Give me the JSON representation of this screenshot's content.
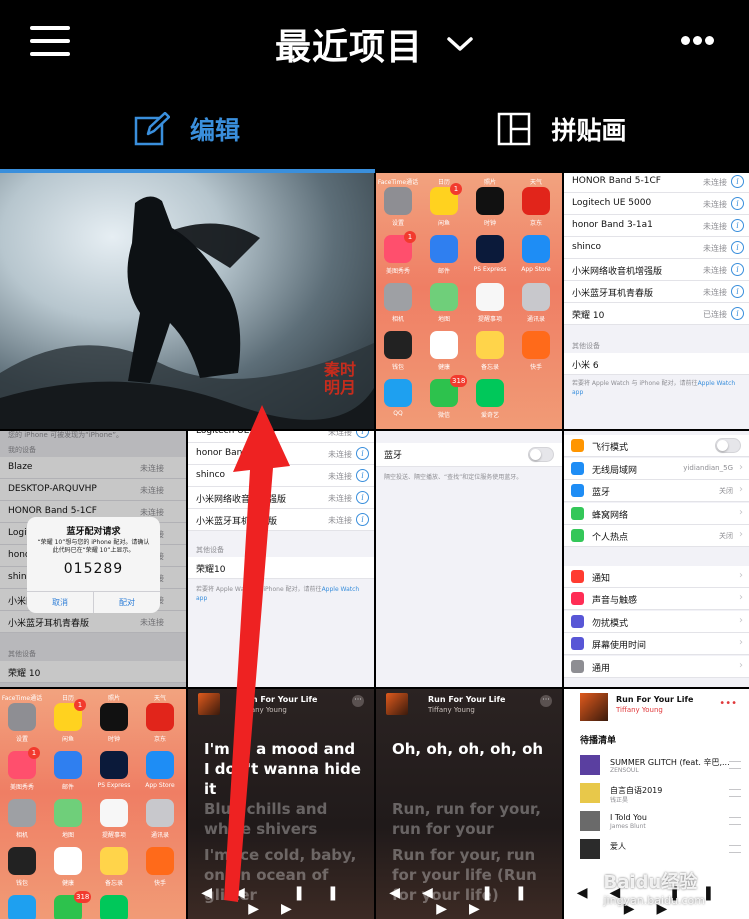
{
  "header": {
    "title": "最近项目"
  },
  "tabs": [
    {
      "label": "编辑"
    },
    {
      "label": "拼贴画"
    }
  ],
  "painting": {
    "seal": "秦时明月"
  },
  "home_apps": [
    {
      "label": "设置",
      "color": "#8e8e93"
    },
    {
      "label": "闲鱼",
      "color": "#ffd21f",
      "badge": "1"
    },
    {
      "label": "时钟",
      "color": "#111111"
    },
    {
      "label": "京东",
      "color": "#e1251b"
    },
    {
      "label": "美图秀秀",
      "color": "#ff4f6d",
      "badge": "1"
    },
    {
      "label": "邮件",
      "color": "#2f7ff0"
    },
    {
      "label": "PS Express",
      "color": "#0b1a3a"
    },
    {
      "label": "App Store",
      "color": "#1e8df5"
    },
    {
      "label": "相机",
      "color": "#9ea0a4"
    },
    {
      "label": "地图",
      "color": "#6fcf7a"
    },
    {
      "label": "提醒事项",
      "color": "#f7f7f7"
    },
    {
      "label": "通讯录",
      "color": "#c8c8cc"
    },
    {
      "label": "钱包",
      "color": "#222222"
    },
    {
      "label": "健康",
      "color": "#ffffff"
    },
    {
      "label": "备忘录",
      "color": "#ffd44a"
    },
    {
      "label": "快手",
      "color": "#ff6a1a"
    },
    {
      "label": "QQ",
      "color": "#1ea0f0"
    },
    {
      "label": "微信",
      "color": "#2dc24d",
      "badge": "318"
    },
    {
      "label": "爱奇艺",
      "color": "#00c85a"
    }
  ],
  "home_top_labels": [
    "FaceTime通话",
    "日历",
    "照片",
    "天气"
  ],
  "bt_devices_a": [
    {
      "name": "HONOR Band 5-1CF",
      "status": "未连接"
    },
    {
      "name": "Logitech UE 5000",
      "status": "未连接"
    },
    {
      "name": "honor Band 3-1a1",
      "status": "未连接"
    },
    {
      "name": "shinco",
      "status": "未连接"
    },
    {
      "name": "小米网络收音机增强版",
      "status": "未连接"
    },
    {
      "name": "小米蓝牙耳机青春版",
      "status": "未连接"
    },
    {
      "name": "荣耀 10",
      "status": "已连接"
    }
  ],
  "other_devices_label": "其他设备",
  "other_device_a": "小米 6",
  "watch_note": "若要将 Apple Watch 与 iPhone 配对，请前往",
  "watch_link": "Apple Watch app",
  "pair_screen": {
    "top_note": "您的 iPhone 可被发现为“iPhone”。",
    "section_label": "我的设备",
    "devices": [
      {
        "name": "Blaze",
        "status": "未连接"
      },
      {
        "name": "DESKTOP-ARQUVHP",
        "status": "未连接"
      },
      {
        "name": "HONOR Band 5-1CF",
        "status": "未连接"
      },
      {
        "name": "Logitech UE 5000",
        "status": "未连接"
      },
      {
        "name": "honor Band 3-1a1",
        "status": "未连接"
      },
      {
        "name": "shinco",
        "status": "未连接"
      },
      {
        "name": "小米网络收音机增强版",
        "status": "未连接"
      },
      {
        "name": "小米蓝牙耳机青春版",
        "status": "未连接"
      }
    ],
    "other_label": "其他设备",
    "other_device": "荣耀 10",
    "dialog": {
      "title": "蓝牙配对请求",
      "message": "“荣耀 10”想与您的 iPhone 配对。请确认此代码已在“荣耀 10”上显示。",
      "code": "015289",
      "cancel": "取消",
      "pair": "配对"
    }
  },
  "bt_devices_b": [
    {
      "name": "Logitech UE 5000",
      "status": "未连接"
    },
    {
      "name": "honor Band 3-1a1",
      "status": "未连接"
    },
    {
      "name": "shinco",
      "status": "未连接"
    },
    {
      "name": "小米网络收音机增强版",
      "status": "未连接"
    },
    {
      "name": "小米蓝牙耳机青春版",
      "status": "未连接"
    }
  ],
  "other_device_b": "荣耀10",
  "bluetooth_toggle": {
    "label": "蓝牙",
    "note": "隔空投送、隔空播放、“查找”和定位服务使用蓝牙。"
  },
  "settings_main": [
    {
      "label": "飞行模式",
      "color": "#ff9500",
      "value": ""
    },
    {
      "label": "无线局域网",
      "color": "#1e8df5",
      "value": "yidiandian_5G"
    },
    {
      "label": "蓝牙",
      "color": "#1e8df5",
      "value": "关闭"
    },
    {
      "label": "蜂窝网络",
      "color": "#34c759",
      "value": ""
    },
    {
      "label": "个人热点",
      "color": "#34c759",
      "value": "关闭"
    },
    {
      "label": "通知",
      "color": "#ff3b30",
      "value": ""
    },
    {
      "label": "声音与触感",
      "color": "#ff2d55",
      "value": ""
    },
    {
      "label": "勿扰模式",
      "color": "#5856d6",
      "value": ""
    },
    {
      "label": "屏幕使用时间",
      "color": "#5856d6",
      "value": ""
    },
    {
      "label": "通用",
      "color": "#8e8e93",
      "value": ""
    }
  ],
  "music": {
    "song": "Run For Your Life",
    "artist": "Tiffany Young",
    "lyrics_a": [
      "I'm in a mood and I don't wanna hide it",
      "Blue chills and white shivers",
      "I'm ice cold, baby, on an ocean of glitter"
    ],
    "lyrics_b": [
      "Oh, oh, oh, oh, oh",
      "Run, run for your, run for your",
      "Run for your, run for your life (Run for your life)"
    ]
  },
  "queue": {
    "song": "Run For Your Life",
    "artist": "Tiffany Young",
    "title": "待播清单",
    "items": [
      {
        "name": "SUMMER GLITCH (feat. 辛巴,...",
        "artist": "ZENSOUL",
        "color": "#5a3fa0"
      },
      {
        "name": "自言自语2019",
        "artist": "钱正昊",
        "color": "#e8c84a"
      },
      {
        "name": "I Told You",
        "artist": "James Blunt",
        "color": "#6a6a6a"
      },
      {
        "name": "爱人",
        "artist": "",
        "color": "#2b2b2b"
      }
    ]
  },
  "watermark": {
    "brand": "Baidu经验",
    "url": "jingyan.baidu.com"
  }
}
